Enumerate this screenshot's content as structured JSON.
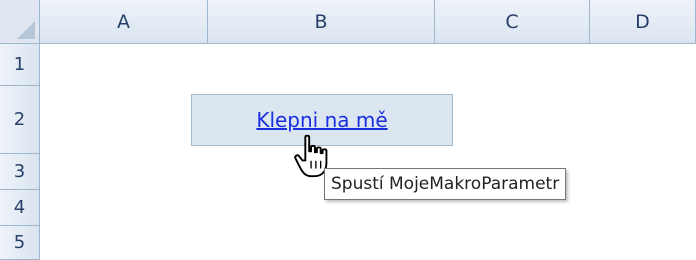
{
  "columns": [
    "A",
    "B",
    "C",
    "D"
  ],
  "rows": [
    "1",
    "2",
    "3",
    "4",
    "5"
  ],
  "button": {
    "label": "Klepni na mě"
  },
  "tooltip": {
    "text": "Spustí MojeMakroParametr"
  },
  "colors": {
    "header_bg": "#dae4f0",
    "header_border": "#9eb6ce",
    "link": "#1a2fe0",
    "button_bg": "#dce6f1"
  }
}
